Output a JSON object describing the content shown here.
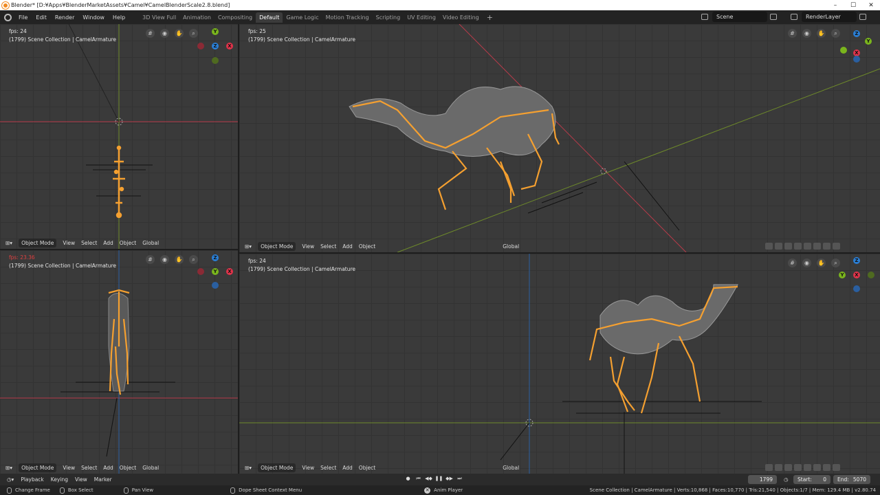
{
  "window": {
    "title": "Blender* [D:¥Apps¥BlenderMarketAssets¥Camel¥CamelBlenderScale2.8.blend]",
    "minimize": "–",
    "maximize": "☐",
    "close": "✕"
  },
  "menu": [
    "File",
    "Edit",
    "Render",
    "Window",
    "Help"
  ],
  "workspaces": [
    "3D View Full",
    "Animation",
    "Compositing",
    "Default",
    "Game Logic",
    "Motion Tracking",
    "Scripting",
    "UV Editing",
    "Video Editing"
  ],
  "active_workspace": "Default",
  "add_tab": "+",
  "scene": "Scene",
  "render_layer": "RenderLayer",
  "viewports": [
    {
      "fps": "fps: 24",
      "collection": "(1799) Scene Collection | CamelArmature",
      "mode": "Object Mode",
      "view": "View",
      "select": "Select",
      "add": "Add",
      "object": "Object",
      "orientation": "Global"
    },
    {
      "fps": "fps: 25",
      "collection": "(1799) Scene Collection | CamelArmature",
      "mode": "Object Mode",
      "view": "View",
      "select": "Select",
      "add": "Add",
      "object": "Object",
      "orientation": "Global"
    },
    {
      "fps": "fps: 23.36",
      "collection": "(1799) Scene Collection | CamelArmature",
      "mode": "Object Mode",
      "view": "View",
      "select": "Select",
      "add": "Add",
      "object": "Object",
      "orientation": "Global"
    },
    {
      "fps": "fps: 24",
      "collection": "(1799) Scene Collection | CamelArmature",
      "mode": "Object Mode",
      "view": "View",
      "select": "Select",
      "add": "Add",
      "object": "Object",
      "orientation": "Global"
    }
  ],
  "gizmo_labels": {
    "x": "X",
    "y": "Y",
    "z": "Z"
  },
  "timeline": {
    "playback": "Playback",
    "keying": "Keying",
    "view": "View",
    "marker": "Marker",
    "current_frame": "1799",
    "start_label": "Start:",
    "start": "0",
    "end_label": "End:",
    "end": "5070"
  },
  "status": {
    "change_frame": "Change Frame",
    "box_select": "Box Select",
    "pan_view": "Pan View",
    "context_menu": "Dope Sheet Context Menu",
    "anim_player": "Anim Player",
    "stats": "Scene Collection | CamelArmature | Verts:10,868 | Faces:10,770 | Tris:21,540 | Objects:1/7 | Mem: 129.4 MB | v2.80.74"
  },
  "colors": {
    "accent": "#f08a22",
    "x_axis": "#e0334a",
    "y_axis": "#7ab51d",
    "z_axis": "#2a7fd6",
    "armature": "#f5a030"
  },
  "icons": [
    "blender-logo-icon",
    "grid-icon",
    "camera-icon",
    "hand-icon",
    "zoom-icon"
  ]
}
